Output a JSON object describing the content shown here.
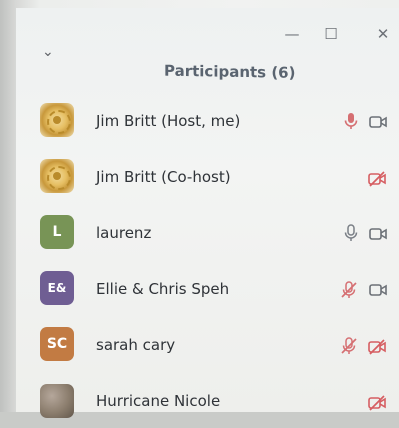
{
  "window": {
    "minimize_label": "—",
    "restore_label": "☐",
    "close_label": "✕",
    "collapse_label": "⌄"
  },
  "header": {
    "title": "Participants (6)"
  },
  "participants": [
    {
      "name": "Jim Britt (Host, me)",
      "avatar_text": "",
      "avatar_type": "rotary",
      "avatar_color": "#d6aa4b",
      "mic": "on",
      "camera": "on"
    },
    {
      "name": "Jim Britt (Co-host)",
      "avatar_text": "",
      "avatar_type": "rotary",
      "avatar_color": "#d6aa4b",
      "mic": "none",
      "camera": "off"
    },
    {
      "name": "laurenz",
      "avatar_text": "L",
      "avatar_type": "letter",
      "avatar_color": "#789456",
      "mic": "on",
      "camera": "on"
    },
    {
      "name": "Ellie & Chris Speh",
      "avatar_text": "E&",
      "avatar_type": "letter",
      "avatar_color": "#6f5e93",
      "mic": "off",
      "camera": "on"
    },
    {
      "name": "sarah cary",
      "avatar_text": "SC",
      "avatar_type": "letter",
      "avatar_color": "#c27b43",
      "mic": "off",
      "camera": "off"
    },
    {
      "name": "Hurricane Nicole",
      "avatar_text": "",
      "avatar_type": "photo",
      "avatar_color": "#8b7d6d",
      "mic": "none",
      "camera": "off"
    }
  ]
}
